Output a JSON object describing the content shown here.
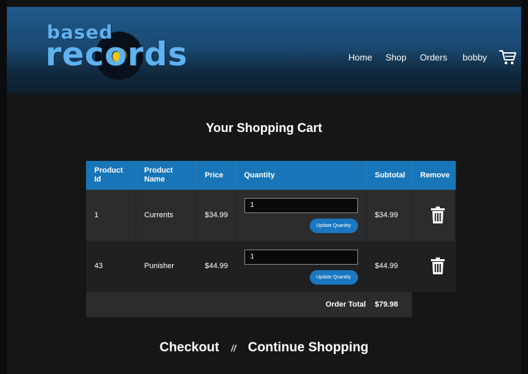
{
  "brand": {
    "line1": "based",
    "line2": "records"
  },
  "nav": {
    "home": "Home",
    "shop": "Shop",
    "orders": "Orders",
    "user": "bobby"
  },
  "icons": {
    "cart": "cart-icon",
    "remove": "trash-icon"
  },
  "colors": {
    "accent": "#1876b8",
    "brand": "#5fb2f0",
    "disc_label": "#f1c40f"
  },
  "page": {
    "title": "Your Shopping Cart"
  },
  "table": {
    "headers": {
      "product_id": "Product Id",
      "product_name": "Product Name",
      "price": "Price",
      "quantity": "Quantity",
      "subtotal": "Subtotal",
      "remove": "Remove"
    },
    "rows": [
      {
        "id": "1",
        "name": "Currents",
        "price": "$34.99",
        "qty": "1",
        "subtotal": "$34.99"
      },
      {
        "id": "43",
        "name": "Punisher",
        "price": "$44.99",
        "qty": "1",
        "subtotal": "$44.99"
      }
    ],
    "update_label": "Update Quantity",
    "total_label": "Order Total",
    "total_value": "$79.98"
  },
  "footer": {
    "checkout": "Checkout",
    "separator": "//",
    "continue": "Continue Shopping"
  }
}
